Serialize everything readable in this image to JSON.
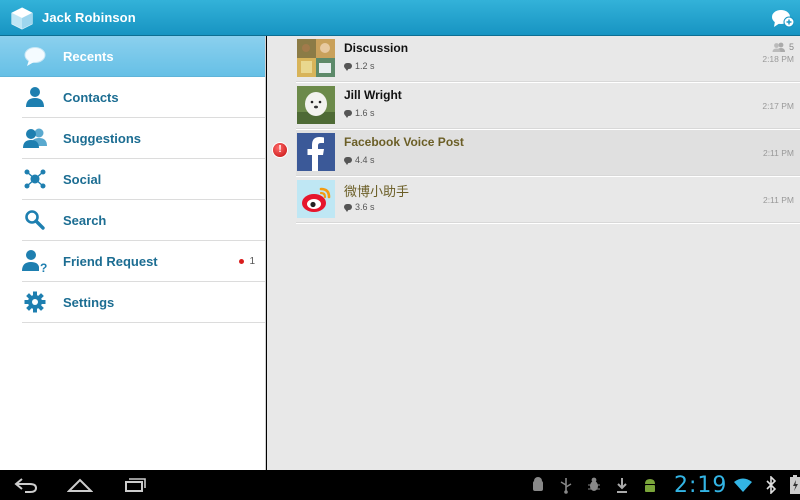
{
  "app": {
    "title": "Jack Robinson"
  },
  "sidebar": {
    "items": [
      {
        "label": "Recents",
        "icon": "chat-bubble-icon",
        "active": true
      },
      {
        "label": "Contacts",
        "icon": "person-icon"
      },
      {
        "label": "Suggestions",
        "icon": "people-icon"
      },
      {
        "label": "Social",
        "icon": "network-icon"
      },
      {
        "label": "Search",
        "icon": "search-icon"
      },
      {
        "label": "Friend Request",
        "icon": "friend-request-icon",
        "badge": "1"
      },
      {
        "label": "Settings",
        "icon": "gear-icon"
      }
    ]
  },
  "conversations": [
    {
      "name": "Discussion",
      "meta": "1.2 s",
      "time": "2:18 PM",
      "members": "5"
    },
    {
      "name": "Jill Wright",
      "meta": "1.6 s",
      "time": "2:17 PM"
    },
    {
      "name": "Facebook Voice Post",
      "meta": "4.4 s",
      "time": "2:11 PM",
      "alert": "!"
    },
    {
      "name": "微博小助手",
      "meta": "3.6 s",
      "time": "2:11 PM"
    }
  ],
  "status_bar": {
    "clock": "2:19"
  },
  "colors": {
    "accent": "#33b5e5",
    "title_bar": "#1794c2",
    "active_item": "#66c0e6",
    "nav_text": "#1c6d92",
    "unread": "#6b5e26"
  }
}
